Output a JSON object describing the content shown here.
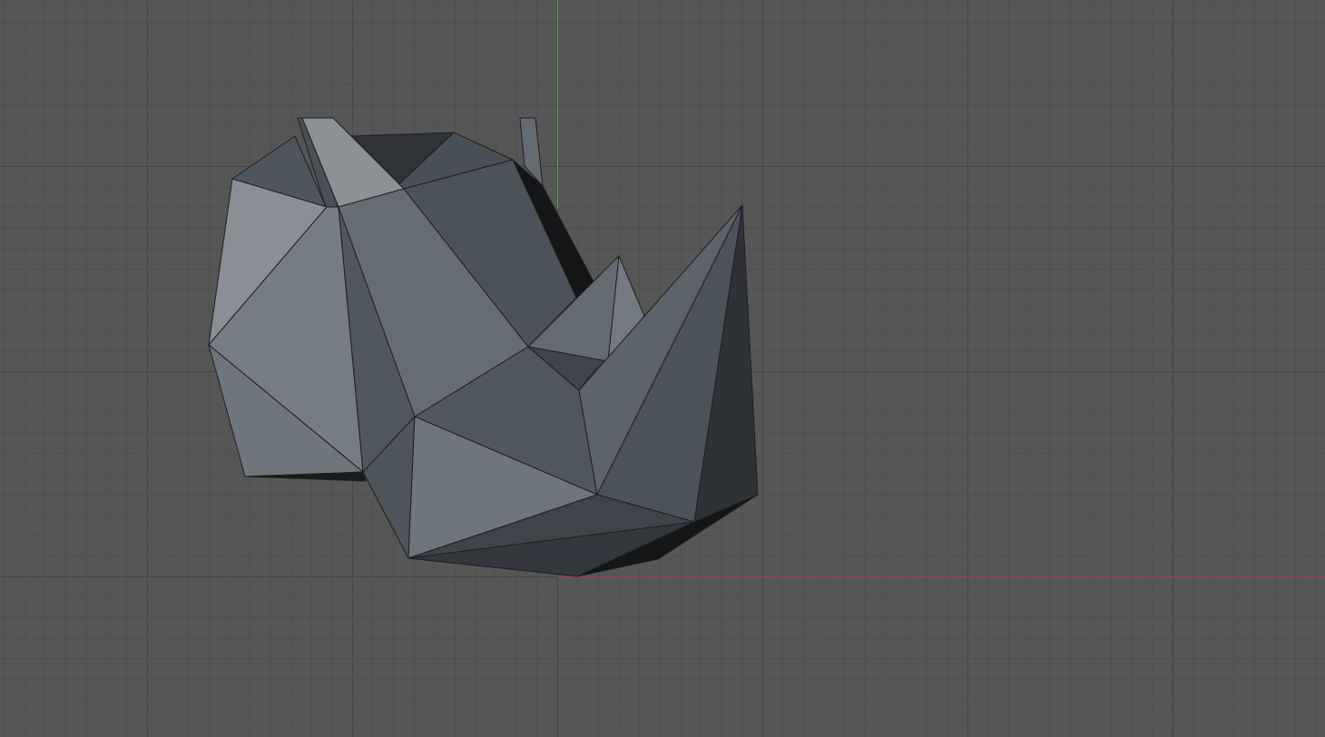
{
  "viewport": {
    "mode": "3D viewport",
    "background_color": "#565656",
    "grid_color": "#404040",
    "x_axis_color": "#b5334a",
    "y_axis_color": "#3fae3f"
  },
  "object": {
    "type": "low-poly rhino head mesh",
    "shading": "solid",
    "face_colors": [
      "#8c9196",
      "#747a81",
      "#626971",
      "#4d535b",
      "#3f444b",
      "#2e3237",
      "#141517"
    ]
  }
}
